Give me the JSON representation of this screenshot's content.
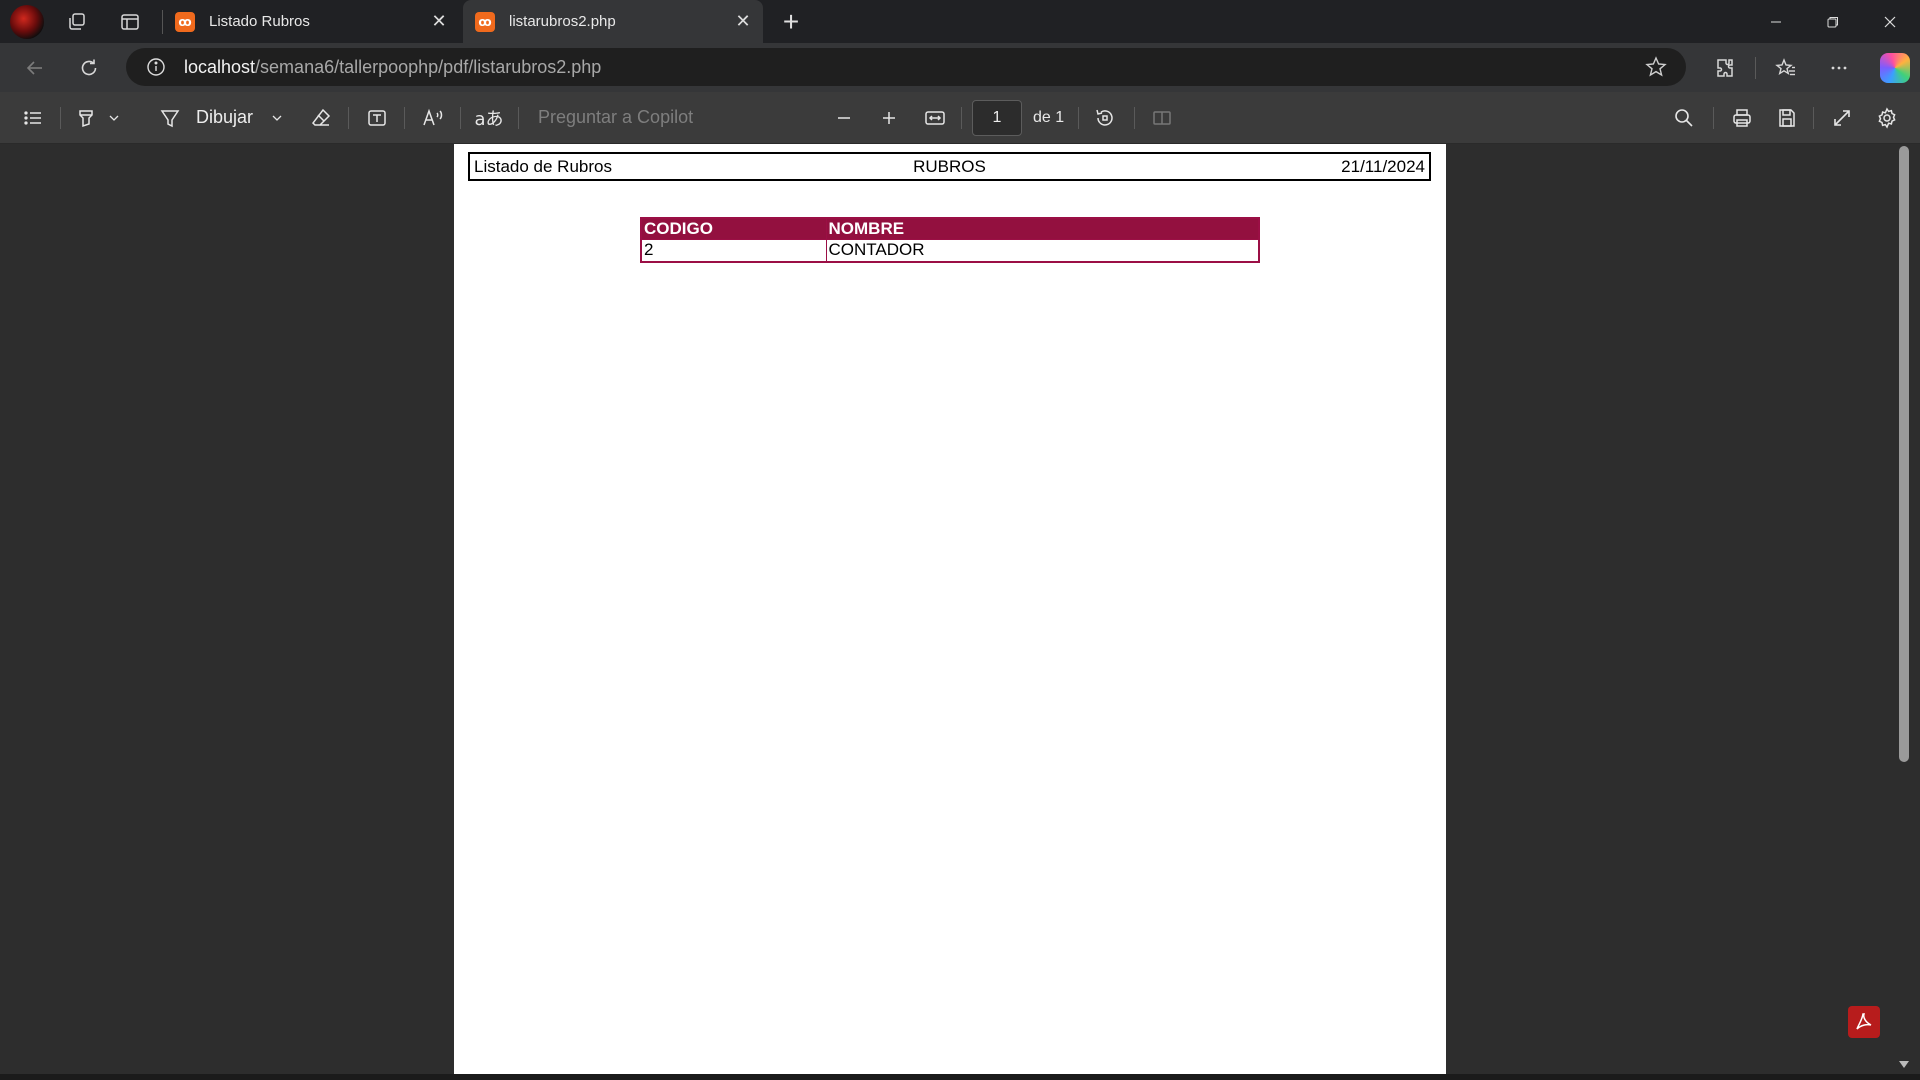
{
  "browser": {
    "tabs": [
      {
        "title": "Listado Rubros",
        "active": false,
        "favicon": "xampp-icon"
      },
      {
        "title": "listarubros2.php",
        "active": true,
        "favicon": "xampp-icon"
      }
    ],
    "favicon_text": "ꝏ",
    "address": {
      "host": "localhost",
      "path": "/semana6/tallerpoophp/pdf/listarubros2.php"
    }
  },
  "pdf_toolbar": {
    "draw_label": "Dibujar",
    "copilot_placeholder": "Preguntar a Copilot",
    "page_current": "1",
    "page_of": "de 1"
  },
  "document": {
    "header": {
      "left": "Listado de Rubros",
      "center": "RUBROS",
      "right": "21/11/2024"
    },
    "table": {
      "columns": [
        "CODIGO",
        "NOMBRE"
      ],
      "rows": [
        [
          "2",
          "CONTADOR"
        ]
      ]
    }
  },
  "colors": {
    "table_header_bg": "#93103f",
    "favicon": "#f06a1d",
    "acrobat": "#b71c1c"
  }
}
